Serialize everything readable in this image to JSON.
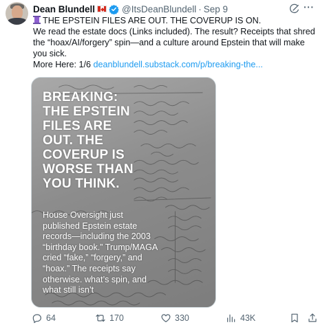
{
  "author": {
    "name": "Dean Blundell",
    "handle": "@ItsDeanBlundell",
    "separator": "·",
    "date": "Sep 9"
  },
  "post": {
    "line1_title": "THE EPSTEIN FILES ARE OUT. THE COVERUP IS ON.",
    "line2": "We read the estate docs (Links included). The result? Receipts that shred",
    "line3": "the “hoax/AI/forgery” spin—and a culture around Epstein that will make",
    "line4": "you sick.",
    "line5_prefix": "More Here: 1/6 ",
    "line5_link": "deanblundell.substack.com/p/breaking-the..."
  },
  "media": {
    "title": "BREAKING:\nTHE EPSTEIN\nFILES ARE\nOUT. THE\nCOVERUP IS\nWORSE THAN\nYOU THINK.",
    "body": "House Oversight just\npublished Epstein estate\nrecords—including the 2003\n“birthday book.” Trump/MAGA\ncried “fake,” “forgery,” and\n“hoax.” The receipts say\notherwise. what’s spin, and\nwhat still isn’t"
  },
  "actions": {
    "replies": "64",
    "reposts": "170",
    "likes": "330",
    "views": "43K"
  },
  "icons": {
    "verified": "verified-badge-icon",
    "grok": "grok-icon",
    "more": "more-icon",
    "reply": "reply-icon",
    "repost": "repost-icon",
    "like": "heart-icon",
    "views": "views-icon",
    "bookmark": "bookmark-icon",
    "share": "share-icon"
  },
  "colors": {
    "accent": "#1d9bf0",
    "text": "#0f1419",
    "muted": "#536471"
  }
}
